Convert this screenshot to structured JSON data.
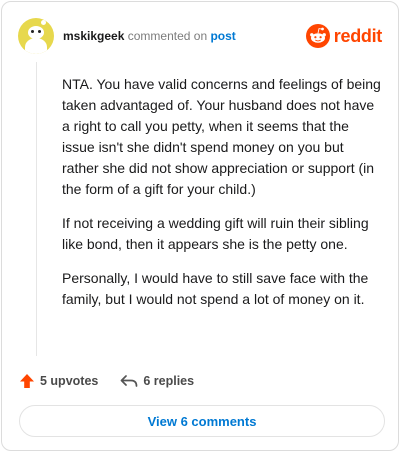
{
  "comment": {
    "username": "mskikgeek",
    "commented_on_text": "commented on",
    "post_link": "post",
    "paragraphs": [
      "NTA. You have valid concerns and feelings of being taken advantaged of. Your husband does not have a right to call you petty, when it seems that the issue isn't she didn't spend money on you but rather she did not show appreciation or support (in the form of a gift for your child.)",
      "If not receiving a wedding gift will ruin their sibling like bond, then it appears she is the petty one.",
      "Personally, I would have to still save face with the family, but I would not spend a lot of money on it."
    ]
  },
  "brand": {
    "wordmark": "reddit",
    "color": "#ff4500"
  },
  "actions": {
    "upvotes_label": "5 upvotes",
    "replies_label": "6 replies",
    "view_comments_label": "View 6 comments"
  },
  "icons": {
    "upvote": "upvote-arrow-icon",
    "reply": "reply-arrow-icon",
    "logo": "reddit-snoo-icon"
  }
}
